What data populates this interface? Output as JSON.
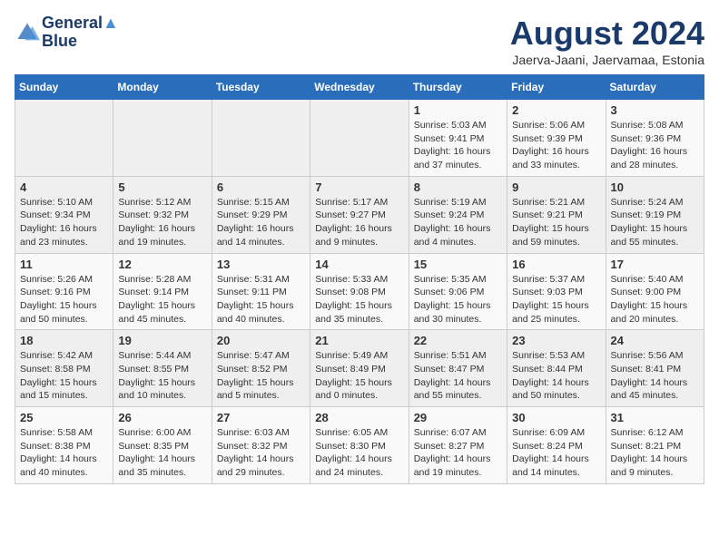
{
  "header": {
    "logo_line1": "General",
    "logo_line2": "Blue",
    "month": "August 2024",
    "location": "Jaerva-Jaani, Jaervamaa, Estonia"
  },
  "weekdays": [
    "Sunday",
    "Monday",
    "Tuesday",
    "Wednesday",
    "Thursday",
    "Friday",
    "Saturday"
  ],
  "weeks": [
    [
      {
        "day": "",
        "info": ""
      },
      {
        "day": "",
        "info": ""
      },
      {
        "day": "",
        "info": ""
      },
      {
        "day": "",
        "info": ""
      },
      {
        "day": "1",
        "info": "Sunrise: 5:03 AM\nSunset: 9:41 PM\nDaylight: 16 hours\nand 37 minutes."
      },
      {
        "day": "2",
        "info": "Sunrise: 5:06 AM\nSunset: 9:39 PM\nDaylight: 16 hours\nand 33 minutes."
      },
      {
        "day": "3",
        "info": "Sunrise: 5:08 AM\nSunset: 9:36 PM\nDaylight: 16 hours\nand 28 minutes."
      }
    ],
    [
      {
        "day": "4",
        "info": "Sunrise: 5:10 AM\nSunset: 9:34 PM\nDaylight: 16 hours\nand 23 minutes."
      },
      {
        "day": "5",
        "info": "Sunrise: 5:12 AM\nSunset: 9:32 PM\nDaylight: 16 hours\nand 19 minutes."
      },
      {
        "day": "6",
        "info": "Sunrise: 5:15 AM\nSunset: 9:29 PM\nDaylight: 16 hours\nand 14 minutes."
      },
      {
        "day": "7",
        "info": "Sunrise: 5:17 AM\nSunset: 9:27 PM\nDaylight: 16 hours\nand 9 minutes."
      },
      {
        "day": "8",
        "info": "Sunrise: 5:19 AM\nSunset: 9:24 PM\nDaylight: 16 hours\nand 4 minutes."
      },
      {
        "day": "9",
        "info": "Sunrise: 5:21 AM\nSunset: 9:21 PM\nDaylight: 15 hours\nand 59 minutes."
      },
      {
        "day": "10",
        "info": "Sunrise: 5:24 AM\nSunset: 9:19 PM\nDaylight: 15 hours\nand 55 minutes."
      }
    ],
    [
      {
        "day": "11",
        "info": "Sunrise: 5:26 AM\nSunset: 9:16 PM\nDaylight: 15 hours\nand 50 minutes."
      },
      {
        "day": "12",
        "info": "Sunrise: 5:28 AM\nSunset: 9:14 PM\nDaylight: 15 hours\nand 45 minutes."
      },
      {
        "day": "13",
        "info": "Sunrise: 5:31 AM\nSunset: 9:11 PM\nDaylight: 15 hours\nand 40 minutes."
      },
      {
        "day": "14",
        "info": "Sunrise: 5:33 AM\nSunset: 9:08 PM\nDaylight: 15 hours\nand 35 minutes."
      },
      {
        "day": "15",
        "info": "Sunrise: 5:35 AM\nSunset: 9:06 PM\nDaylight: 15 hours\nand 30 minutes."
      },
      {
        "day": "16",
        "info": "Sunrise: 5:37 AM\nSunset: 9:03 PM\nDaylight: 15 hours\nand 25 minutes."
      },
      {
        "day": "17",
        "info": "Sunrise: 5:40 AM\nSunset: 9:00 PM\nDaylight: 15 hours\nand 20 minutes."
      }
    ],
    [
      {
        "day": "18",
        "info": "Sunrise: 5:42 AM\nSunset: 8:58 PM\nDaylight: 15 hours\nand 15 minutes."
      },
      {
        "day": "19",
        "info": "Sunrise: 5:44 AM\nSunset: 8:55 PM\nDaylight: 15 hours\nand 10 minutes."
      },
      {
        "day": "20",
        "info": "Sunrise: 5:47 AM\nSunset: 8:52 PM\nDaylight: 15 hours\nand 5 minutes."
      },
      {
        "day": "21",
        "info": "Sunrise: 5:49 AM\nSunset: 8:49 PM\nDaylight: 15 hours\nand 0 minutes."
      },
      {
        "day": "22",
        "info": "Sunrise: 5:51 AM\nSunset: 8:47 PM\nDaylight: 14 hours\nand 55 minutes."
      },
      {
        "day": "23",
        "info": "Sunrise: 5:53 AM\nSunset: 8:44 PM\nDaylight: 14 hours\nand 50 minutes."
      },
      {
        "day": "24",
        "info": "Sunrise: 5:56 AM\nSunset: 8:41 PM\nDaylight: 14 hours\nand 45 minutes."
      }
    ],
    [
      {
        "day": "25",
        "info": "Sunrise: 5:58 AM\nSunset: 8:38 PM\nDaylight: 14 hours\nand 40 minutes."
      },
      {
        "day": "26",
        "info": "Sunrise: 6:00 AM\nSunset: 8:35 PM\nDaylight: 14 hours\nand 35 minutes."
      },
      {
        "day": "27",
        "info": "Sunrise: 6:03 AM\nSunset: 8:32 PM\nDaylight: 14 hours\nand 29 minutes."
      },
      {
        "day": "28",
        "info": "Sunrise: 6:05 AM\nSunset: 8:30 PM\nDaylight: 14 hours\nand 24 minutes."
      },
      {
        "day": "29",
        "info": "Sunrise: 6:07 AM\nSunset: 8:27 PM\nDaylight: 14 hours\nand 19 minutes."
      },
      {
        "day": "30",
        "info": "Sunrise: 6:09 AM\nSunset: 8:24 PM\nDaylight: 14 hours\nand 14 minutes."
      },
      {
        "day": "31",
        "info": "Sunrise: 6:12 AM\nSunset: 8:21 PM\nDaylight: 14 hours\nand 9 minutes."
      }
    ]
  ]
}
